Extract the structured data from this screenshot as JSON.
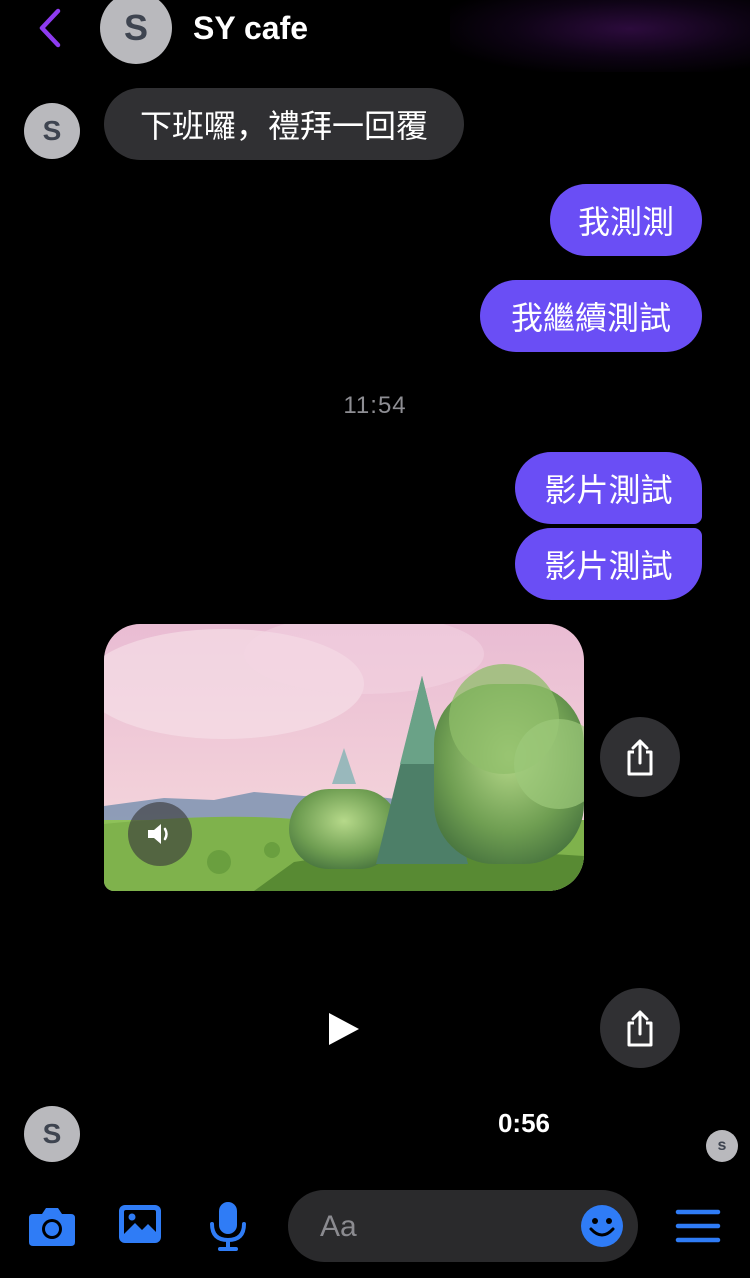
{
  "header": {
    "title": "SY cafe",
    "avatar_letter": "S",
    "back_icon": "chevron-left-icon",
    "accent_color": "#8e3bf0"
  },
  "messages": [
    {
      "direction": "incoming",
      "text": "下班囉，禮拜一回覆"
    },
    {
      "direction": "outgoing",
      "text": "我測測"
    },
    {
      "direction": "outgoing",
      "text": "我繼續測試"
    },
    {
      "direction": "outgoing",
      "text": "影片測試"
    },
    {
      "direction": "outgoing",
      "text": "影片測試"
    }
  ],
  "timestamp": "11:54",
  "video": {
    "mute_icon": "speaker-icon",
    "share_icon": "share-icon",
    "play_icon": "play-icon",
    "duration": "0:56"
  },
  "avatars": {
    "incoming_letter": "S",
    "read_receipt_letter": "s"
  },
  "composer": {
    "placeholder": "Aa",
    "icons": [
      "camera-icon",
      "image-icon",
      "microphone-icon",
      "emoji-icon",
      "menu-icon"
    ]
  },
  "colors": {
    "outgoing_bubble": "#6a4ef5",
    "incoming_bubble": "#303033",
    "toolbar_icon": "#2f7cf6",
    "background": "#000000"
  }
}
